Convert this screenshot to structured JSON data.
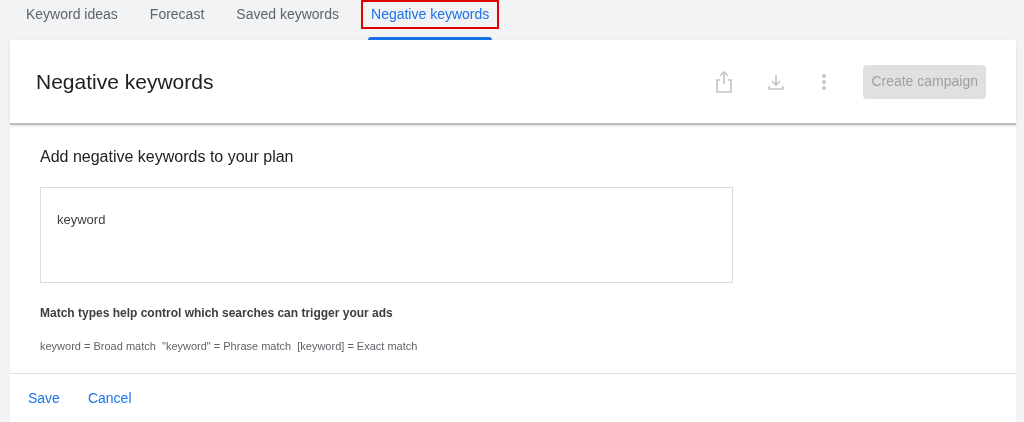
{
  "tabs": [
    {
      "label": "Keyword ideas",
      "selected": false,
      "highlighted": false
    },
    {
      "label": "Forecast",
      "selected": false,
      "highlighted": false
    },
    {
      "label": "Saved keywords",
      "selected": false,
      "highlighted": false
    },
    {
      "label": "Negative keywords",
      "selected": true,
      "highlighted": true
    }
  ],
  "header": {
    "title": "Negative keywords",
    "create_button": {
      "label": "Create campaign",
      "disabled": true
    }
  },
  "form": {
    "heading": "Add negative keywords to your plan",
    "input_value": "keyword",
    "hint_title": "Match types help control which searches can trigger your ads",
    "hint_text": "keyword = Broad match  \"keyword\" = Phrase match  [keyword] = Exact match"
  },
  "actions": [
    "Save",
    "Cancel"
  ]
}
